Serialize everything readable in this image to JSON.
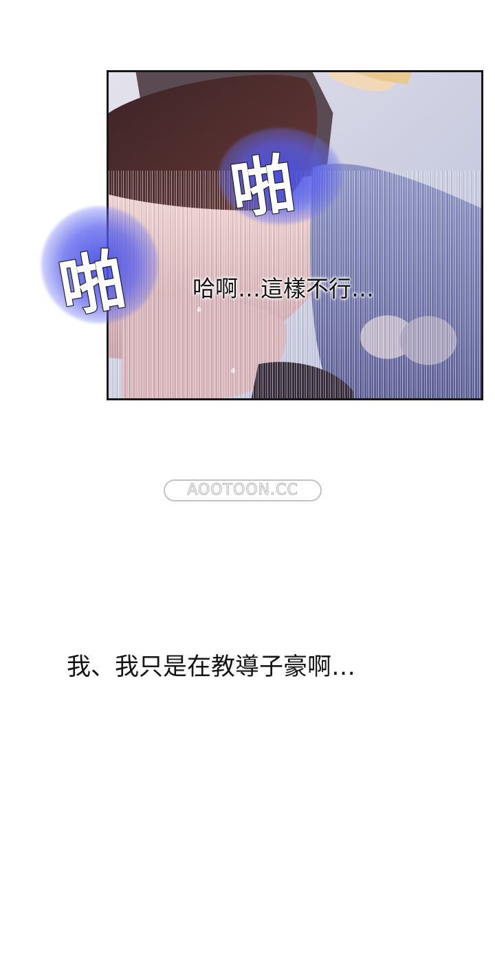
{
  "panel": {
    "sfx": [
      "啪",
      "啪"
    ],
    "dialogue": "哈啊…這樣不行…"
  },
  "watermark": {
    "text": "AOOTOON.CC"
  },
  "narration": {
    "text": "我、我只是在教導子豪啊…"
  },
  "colors": {
    "panel_border": "#161616",
    "sfx_glow": "#5a5fe8",
    "skin": "#e9c7c4",
    "stocking": "#4a2a2c",
    "background": "#ffffff"
  }
}
